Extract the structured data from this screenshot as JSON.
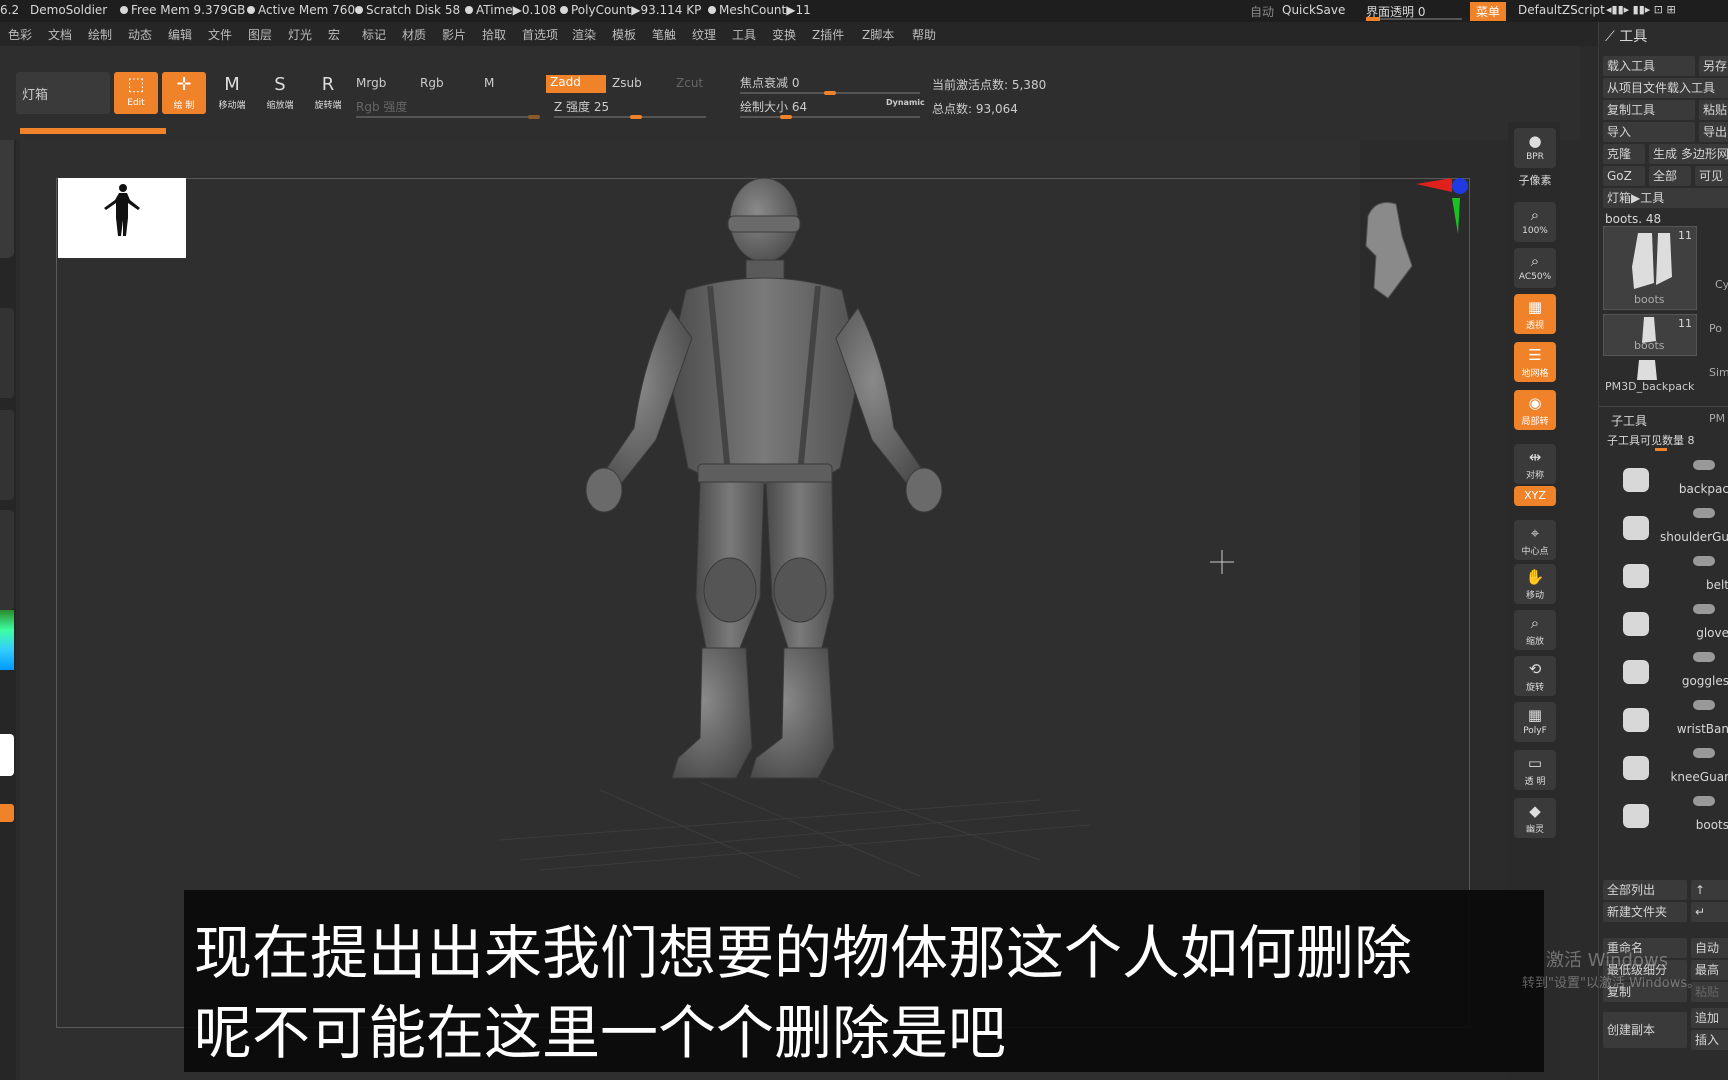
{
  "status": {
    "version": "6.2",
    "file": "DemoSoldier",
    "free_mem": "Free Mem 9.379GB",
    "active_mem": "Active Mem 760",
    "scratch": "Scratch Disk 58",
    "atime": "ATime▶0.108",
    "polycount": "PolyCount▶93.114 KP",
    "meshcount": "MeshCount▶11",
    "auto": "自动",
    "quicksave": "QuickSave",
    "ui_transparency": "界面透明 0",
    "menu": "菜单",
    "script": "DefaultZScript"
  },
  "menu": [
    "色彩",
    "文档",
    "绘制",
    "动态",
    "编辑",
    "文件",
    "图层",
    "灯光",
    "宏",
    "标记",
    "材质",
    "影片",
    "拾取",
    "首选项",
    "渲染",
    "模板",
    "笔触",
    "纹理",
    "工具",
    "变换",
    "Z插件",
    "Z脚本",
    "帮助"
  ],
  "toolbar": {
    "lightbox": "灯箱",
    "edit_label": "Edit",
    "draw_label": "绘 制",
    "move_label": "移动端",
    "scale_label": "缩放端",
    "rotate_label": "旋转端",
    "mrgb": "Mrgb",
    "rgb": "Rgb",
    "m": "M",
    "rgb_intensity": "Rgb 强度",
    "zadd": "Zadd",
    "zsub": "Zsub",
    "zcut": "Zcut",
    "z_intensity": "Z 强度 25",
    "focal_shift": "焦点衰减 0",
    "draw_size": "绘制大小 64",
    "dynamic": "Dynamic",
    "active_points": "当前激活点数: 5,380",
    "total_points": "总点数: 93,064"
  },
  "right_icons": [
    {
      "name": "bpr-button",
      "label": "BPR",
      "glyph": "●",
      "on": false
    },
    {
      "name": "subpixel-label",
      "label": "子像素",
      "glyph": "",
      "on": false
    },
    {
      "name": "zoom-100-button",
      "label": "100%",
      "glyph": "⌕",
      "on": false
    },
    {
      "name": "zoom-ac50-button",
      "label": "AC50%",
      "glyph": "⌕",
      "on": false
    },
    {
      "name": "perspective-button",
      "label": "透视",
      "glyph": "▦",
      "on": true
    },
    {
      "name": "floor-button",
      "label": "地网格",
      "glyph": "☰",
      "on": true
    },
    {
      "name": "local-rotate-button",
      "label": "局部转",
      "glyph": "◉",
      "on": true
    },
    {
      "name": "symmetry-button",
      "label": "对称",
      "glyph": "⇹",
      "on": false
    },
    {
      "name": "xyz-button",
      "label": "XYZ",
      "glyph": "",
      "on": true
    },
    {
      "name": "frame-button",
      "label": "中心点",
      "glyph": "⌖",
      "on": false
    },
    {
      "name": "move-view-button",
      "label": "移动",
      "glyph": "✋",
      "on": false
    },
    {
      "name": "scale-view-button",
      "label": "缩放",
      "glyph": "⌕",
      "on": false
    },
    {
      "name": "rotate-view-button",
      "label": "旋转",
      "glyph": "⟲",
      "on": false
    },
    {
      "name": "polyframe-button",
      "label": "PolyF",
      "glyph": "▦",
      "on": false
    },
    {
      "name": "transparent-button",
      "label": "透 明",
      "glyph": "▭",
      "on": false
    },
    {
      "name": "ghost-button",
      "label": "幽灵",
      "glyph": "◆",
      "on": false
    }
  ],
  "palette": {
    "title": "工具",
    "load_tool": "载入工具",
    "save_as": "另存",
    "load_from_project": "从项目文件载入工具",
    "copy_tool": "复制工具",
    "paste": "粘贴",
    "import": "导入",
    "export": "导出",
    "clone": "克隆",
    "make_polymesh": "生成 多边形网",
    "goz": "GoZ",
    "all": "全部",
    "visible": "可见",
    "lightbox_tool": "灯箱▶工具",
    "current_tool": "boots. 48",
    "thumb1_label": "boots",
    "thumb1_count": "11",
    "thumb2_label": "boots",
    "thumb2_count": "11",
    "thumb3_label": "PM3D_backpack",
    "side_labels": [
      "Cy",
      "Po",
      "Sim",
      "PM"
    ],
    "subtool_title": "子工具",
    "visible_count": "子工具可见数量 8",
    "subtools": [
      "backpac",
      "shoulderGu",
      "belt",
      "glove",
      "goggles",
      "wristBan",
      "kneeGuar",
      "boots"
    ],
    "list_all": "全部列出",
    "new_folder": "新建文件夹",
    "rename": "重命名",
    "auto": "自动",
    "lowest_subdiv": "最低级细分",
    "highest": "最高",
    "duplicate": "复制",
    "paste2": "粘贴",
    "create_copy": "创建副本",
    "append": "追加",
    "insert": "插入"
  },
  "subtitle": {
    "line1": "现在提出出来我们想要的物体那这个人如何删除",
    "line2": "呢不可能在这里一个个删除是吧"
  },
  "watermark": {
    "line1": "激活 Windows",
    "line2": "转到\"设置\"以激活 Windows。"
  },
  "colors": {
    "accent": "#f0822a",
    "background": "#2b2b2b"
  }
}
